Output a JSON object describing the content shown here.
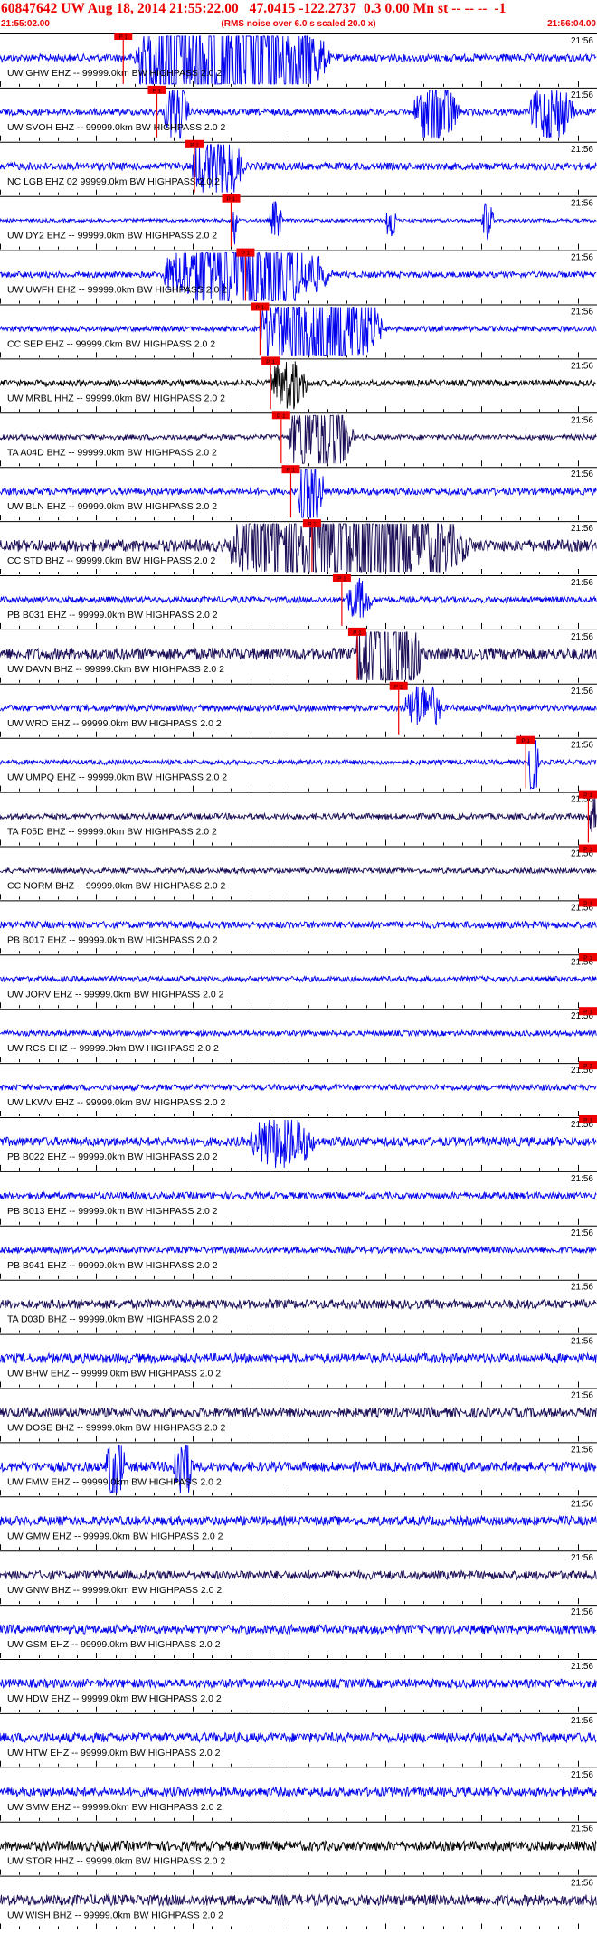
{
  "header": {
    "title": "60847642 UW Aug 18, 2014 21:55:22.00   47.0415 -122.2737  0.3 0.00 Mn st -- -- --  -1",
    "start_time": "21:55:02.00",
    "scale_note": "(RMS noise over 6.0 s scaled 20.0 x)",
    "end_time": "21:56:04.00"
  },
  "colors": {
    "title": "#ee0000",
    "trace_blue": "#0000ee",
    "trace_dark": "#1a0b55",
    "trace_black": "#000000",
    "pick_red": "#ee0000",
    "grid": "#000000"
  },
  "chart_data": {
    "type": "seismogram",
    "minute_label": "21:56",
    "pick_label": "P 1",
    "traces": [
      {
        "label": "UW GHW EHZ -- 99999.0km BW  HIGHPASS  2.0  2",
        "color": "blue",
        "amp": 0.35,
        "pick": 12.8,
        "bursts": [
          [
            14,
            44,
            5.5
          ]
        ]
      },
      {
        "label": "UW SVOH EHZ -- 99999.0km BW  HIGHPASS  2.0  2",
        "color": "blue",
        "amp": 0.3,
        "pick": 16.3,
        "bursts": [
          [
            17,
            21,
            2.2
          ],
          [
            43,
            50,
            2.8
          ],
          [
            55,
            62,
            2.2
          ]
        ]
      },
      {
        "label": "NC LGB EHZ 02 99999.0km BW  HIGHPASS  2.0  2",
        "color": "blue",
        "amp": 0.35,
        "pick": 20.2,
        "bursts": [
          [
            20,
            28,
            2.5
          ]
        ]
      },
      {
        "label": "UW DY2 EHZ -- 99999.0km BW  HIGHPASS  2.0  2",
        "color": "blue",
        "amp": 0.15,
        "pick": 24.0,
        "bursts": [
          [
            24,
            25,
            4.0
          ],
          [
            28,
            30,
            3.0
          ],
          [
            40,
            42,
            3.0
          ],
          [
            50,
            52,
            3.0
          ]
        ]
      },
      {
        "label": "UW UWFH EHZ -- 99999.0km BW  HIGHPASS  2.0  2",
        "color": "blue",
        "amp": 0.28,
        "pick": 25.5,
        "bursts": [
          [
            17,
            43,
            3.8
          ]
        ]
      },
      {
        "label": "CC SEP EHZ -- 99999.0km BW  HIGHPASS  2.0  2",
        "color": "blue",
        "amp": 0.25,
        "pick": 27.0,
        "bursts": [
          [
            27,
            46,
            6.0
          ]
        ]
      },
      {
        "label": "UW MRBL HHZ -- 99999.0km BW  HIGHPASS  2.0  2",
        "color": "black",
        "amp": 0.28,
        "pick": 28.1,
        "bursts": [
          [
            28,
            34,
            2.2
          ]
        ]
      },
      {
        "label": "TA A04D BHZ -- 99999.0km BW  HIGHPASS  2.0  2",
        "color": "dark",
        "amp": 0.25,
        "pick": 29.2,
        "bursts": [
          [
            30,
            40,
            4.8
          ]
        ]
      },
      {
        "label": "UW BLN EHZ -- 99999.0km BW  HIGHPASS  2.0  2",
        "color": "blue",
        "amp": 0.32,
        "pick": 30.2,
        "bursts": [
          [
            31,
            35,
            3.5
          ]
        ]
      },
      {
        "label": "CC STD BHZ -- 99999.0km BW  HIGHPASS  2.0  2",
        "color": "dark",
        "amp": 0.55,
        "pick": 32.4,
        "bursts": [
          [
            24,
            61,
            2.3
          ]
        ]
      },
      {
        "label": "PB B031 EHZ -- 99999.0km BW  HIGHPASS  2.0  2",
        "color": "blue",
        "amp": 0.28,
        "pick": 35.5,
        "bursts": [
          [
            36,
            40,
            1.6
          ]
        ]
      },
      {
        "label": "UW DAVN BHZ -- 99999.0km BW  HIGHPASS  2.0  2",
        "color": "dark",
        "amp": 0.55,
        "pick": 37.1,
        "bursts": [
          [
            37,
            47,
            3.8
          ]
        ]
      },
      {
        "label": "UW WRD EHZ -- 99999.0km BW  HIGHPASS  2.0  2",
        "color": "blue",
        "amp": 0.3,
        "pick": 41.4,
        "bursts": [
          [
            42,
            48,
            1.8
          ]
        ]
      },
      {
        "label": "UW UMPQ EHZ -- 99999.0km BW  HIGHPASS  2.0  2",
        "color": "blue",
        "amp": 0.22,
        "pick": 54.6,
        "bursts": [
          [
            54.8,
            56.5,
            4.5
          ],
          [
            62,
            64,
            3.5
          ]
        ]
      },
      {
        "label": "TA F05D BHZ -- 99999.0km BW  HIGHPASS  2.0  2",
        "color": "dark",
        "amp": 0.28,
        "pick": 61.1,
        "bursts": [
          [
            61,
            64,
            1.5
          ]
        ]
      },
      {
        "label": "CC NORM BHZ -- 99999.0km BW  HIGHPASS  2.0  2",
        "color": "dark",
        "amp": 0.25,
        "pick": 65.7,
        "bursts": [
          [
            66,
            88,
            6.0
          ]
        ]
      },
      {
        "label": "PB B017 EHZ -- 99999.0km BW  HIGHPASS  2.0  2",
        "color": "blue",
        "amp": 0.32,
        "pick": 66.5,
        "bursts": [
          [
            62,
            74,
            3.0
          ]
        ]
      },
      {
        "label": "UW JORV EHZ -- 99999.0km BW  HIGHPASS  2.0  2",
        "color": "blue",
        "amp": 0.25,
        "pick": 70.9,
        "bursts": [
          [
            71,
            73,
            2.0
          ]
        ]
      },
      {
        "label": "UW RCS EHZ -- 99999.0km BW  HIGHPASS  2.0  2",
        "color": "blue",
        "amp": 0.25,
        "pick": 72.0,
        "bursts": [
          [
            72,
            90,
            4.0
          ]
        ]
      },
      {
        "label": "UW LKWV EHZ -- 99999.0km BW  HIGHPASS  2.0  2",
        "color": "blue",
        "amp": 0.28,
        "pick": 80.4,
        "bursts": [
          [
            80,
            88,
            2.8
          ]
        ]
      },
      {
        "label": "PB B022 EHZ -- 99999.0km BW  HIGHPASS  2.0  2",
        "color": "blue",
        "amp": 0.42,
        "pick": 85.5,
        "bursts": [
          [
            26,
            36,
            1.5
          ]
        ]
      },
      {
        "label": "PB B013 EHZ -- 99999.0km BW  HIGHPASS  2.0  2",
        "color": "blue",
        "amp": 0.32,
        "pick": null,
        "bursts": []
      },
      {
        "label": "PB B941 EHZ -- 99999.0km BW  HIGHPASS  2.0  2",
        "color": "blue",
        "amp": 0.3,
        "pick": null,
        "bursts": []
      },
      {
        "label": "TA D03D BHZ -- 99999.0km BW  HIGHPASS  2.0  2",
        "color": "dark",
        "amp": 0.42,
        "pick": null,
        "bursts": []
      },
      {
        "label": "UW BHW EHZ -- 99999.0km BW  HIGHPASS  2.0  2",
        "color": "blue",
        "amp": 0.45,
        "pick": null,
        "bursts": []
      },
      {
        "label": "UW DOSE BHZ -- 99999.0km BW  HIGHPASS  2.0  2",
        "color": "dark",
        "amp": 0.45,
        "pick": null,
        "bursts": []
      },
      {
        "label": "UW FMW EHZ -- 99999.0km BW  HIGHPASS  2.0  2",
        "color": "blue",
        "amp": 0.45,
        "pick": null,
        "bursts": [
          [
            11,
            14,
            2.0
          ],
          [
            18,
            21,
            2.0
          ]
        ]
      },
      {
        "label": "UW GMW EHZ -- 99999.0km BW  HIGHPASS  2.0  2",
        "color": "blue",
        "amp": 0.42,
        "pick": null,
        "bursts": []
      },
      {
        "label": "UW GNW BHZ -- 99999.0km BW  HIGHPASS  2.0  2",
        "color": "dark",
        "amp": 0.4,
        "pick": null,
        "bursts": []
      },
      {
        "label": "UW GSM EHZ -- 99999.0km BW  HIGHPASS  2.0  2",
        "color": "blue",
        "amp": 0.42,
        "pick": null,
        "bursts": []
      },
      {
        "label": "UW HDW EHZ -- 99999.0km BW  HIGHPASS  2.0  2",
        "color": "blue",
        "amp": 0.4,
        "pick": null,
        "bursts": []
      },
      {
        "label": "UW HTW EHZ -- 99999.0km BW  HIGHPASS  2.0  2",
        "color": "blue",
        "amp": 0.45,
        "pick": null,
        "bursts": []
      },
      {
        "label": "UW SMW EHZ -- 99999.0km BW  HIGHPASS  2.0  2",
        "color": "blue",
        "amp": 0.42,
        "pick": null,
        "bursts": []
      },
      {
        "label": "UW STOR HHZ -- 99999.0km BW  HIGHPASS  2.0  2",
        "color": "black",
        "amp": 0.45,
        "pick": null,
        "bursts": []
      },
      {
        "label": "UW WISH BHZ -- 99999.0km BW  HIGHPASS  2.0  2",
        "color": "dark",
        "amp": 0.5,
        "pick": null,
        "bursts": []
      }
    ]
  }
}
